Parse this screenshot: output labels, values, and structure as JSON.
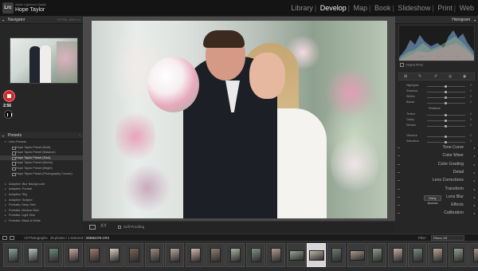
{
  "app": {
    "name": "Adobe Lightroom Classic",
    "user": "Hope Taylor",
    "logo": "Lrc"
  },
  "modules": [
    "Library",
    "Develop",
    "Map",
    "Book",
    "Slideshow",
    "Print",
    "Web"
  ],
  "active_module": "Develop",
  "navigator": {
    "title": "Navigator",
    "options": "FIT  FILL  100%  1:1"
  },
  "recording": {
    "time": "2:56"
  },
  "presets": {
    "title": "Presets",
    "items": [
      {
        "label": "User Presets",
        "kind": "folder-open"
      },
      {
        "label": "Hope Taylor Preset (Bold)",
        "kind": "sub"
      },
      {
        "label": "Hope Taylor Preset (Balance)",
        "kind": "sub"
      },
      {
        "label": "Hope Taylor Preset (Soul)",
        "kind": "sub-hover"
      },
      {
        "label": "Hope Taylor Preset (Bricks)",
        "kind": "sub"
      },
      {
        "label": "Hope Taylor Preset (Bright)",
        "kind": "sub"
      },
      {
        "label": "Hope Taylor Preset (Photography Course)",
        "kind": "sub"
      },
      {
        "label": "",
        "kind": "spacer"
      },
      {
        "label": "Adaptive: Blur Background",
        "kind": "folder"
      },
      {
        "label": "Adaptive: Portrait",
        "kind": "folder"
      },
      {
        "label": "Adaptive: Sky",
        "kind": "folder"
      },
      {
        "label": "Adaptive: Subject",
        "kind": "folder"
      },
      {
        "label": "Portraits: Deep Skin",
        "kind": "folder"
      },
      {
        "label": "Portraits: Medium Skin",
        "kind": "folder"
      },
      {
        "label": "Portraits: Light Skin",
        "kind": "folder"
      },
      {
        "label": "Portraits: Black & White",
        "kind": "folder"
      }
    ]
  },
  "left_buttons": {
    "copy": "Copy...",
    "paste": "Paste"
  },
  "toolbar": {
    "soft_proofing": "Soft Proofing"
  },
  "histogram": {
    "title": "Histogram",
    "readouts": [
      "100",
      "28mm",
      "f/1.8",
      "1/200"
    ]
  },
  "original_photo": "Original Photo",
  "sliders": [
    {
      "label": "Highlights",
      "value": "0"
    },
    {
      "label": "Shadows",
      "value": "0"
    },
    {
      "label": "Whites",
      "value": "0"
    },
    {
      "label": "Blacks",
      "value": "0"
    },
    {
      "label": "Texture",
      "value": "0"
    },
    {
      "label": "Clarity",
      "value": "0"
    },
    {
      "label": "Dehaze",
      "value": "0"
    },
    {
      "label": "Vibrance",
      "value": "0"
    },
    {
      "label": "Saturation",
      "value": "0"
    }
  ],
  "presence_label": "Presence",
  "right_sections": [
    "Tone Curve",
    "Color Mixer",
    "Color Grading",
    "Detail",
    "Lens Corrections",
    "Transform",
    "Lens Blur",
    "Effects",
    "Calibration"
  ],
  "lens_blur_badge": "Early Access",
  "right_buttons": {
    "previous": "Previous",
    "reset": "Reset"
  },
  "strip": {
    "source": "All Photographs",
    "count": "26 photos / 1 selected /",
    "filename": "2DB84376.CR3",
    "filter_label": "Filter :",
    "filter_value": "Filters Off"
  },
  "colors": {
    "accent": "#d12a2a",
    "panel": "#262626",
    "background": "#1e1e1e"
  }
}
